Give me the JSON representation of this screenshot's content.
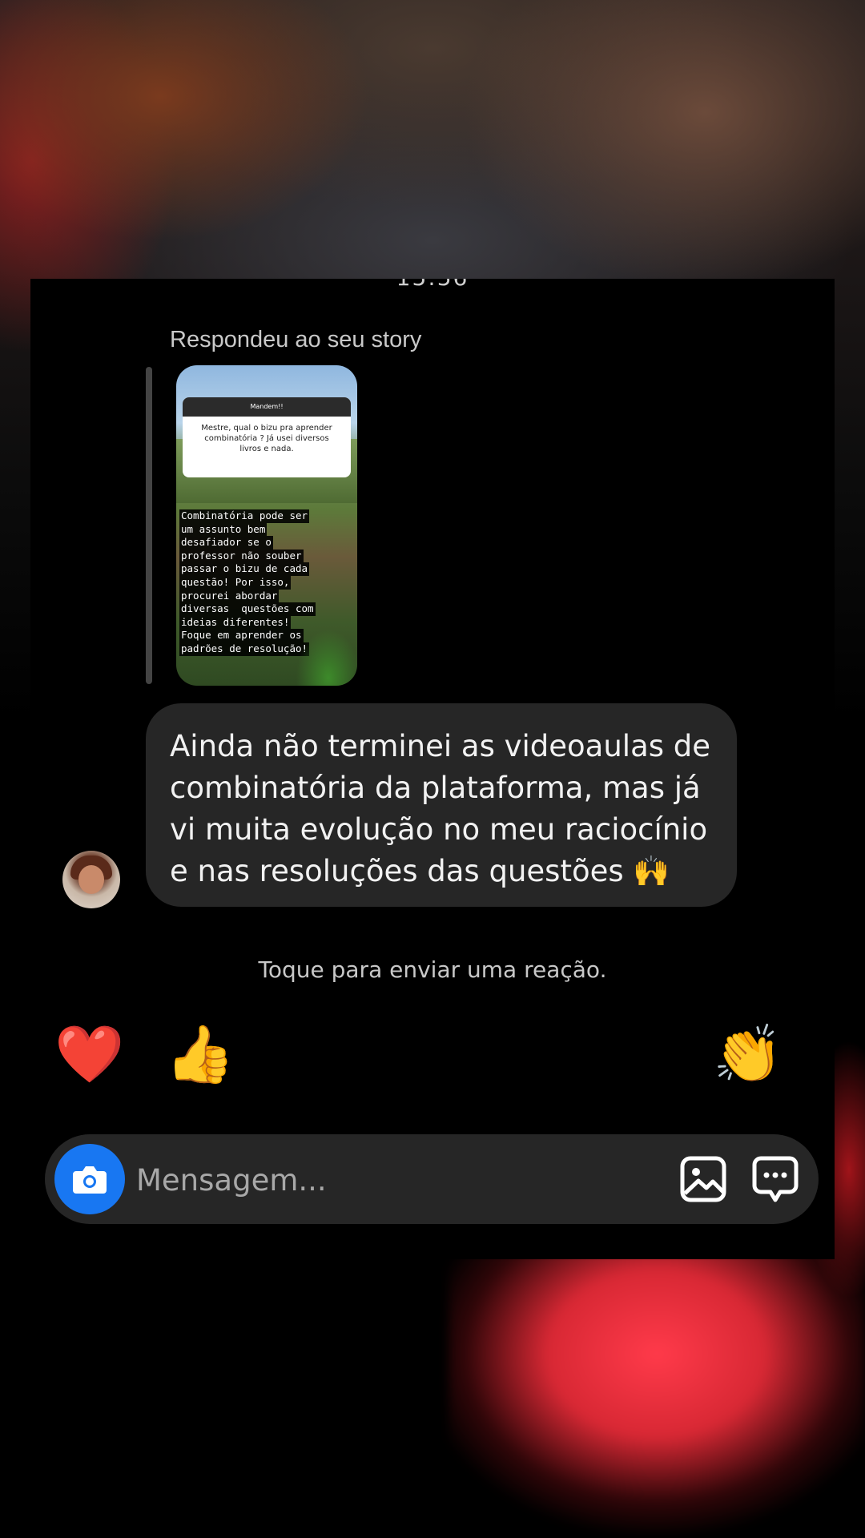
{
  "status_time_partial": "15:56",
  "thread": {
    "replied_label": "Respondeu ao seu story",
    "story": {
      "question_header": "Mandem!!",
      "question_text": "Mestre, qual o bizu pra aprender combinatória ? Já usei diversos livros e nada.",
      "answer_lines": [
        "Combinatória pode ser",
        "um assunto bem",
        "desafiador se o",
        "professor não souber",
        "passar o bizu de cada",
        "questão! Por isso,",
        "procurei abordar",
        "diversas  questões com",
        "ideias diferentes!",
        "Foque em aprender os",
        "padrões de resolução!"
      ]
    },
    "message_text": "Ainda não terminei as videoaulas de combinatória da plataforma, mas já vi muita evolução no meu raciocínio e nas resoluções das questões 🙌"
  },
  "reactions": {
    "hint": "Toque para enviar uma reação.",
    "emojis": [
      "❤️",
      "👍",
      "😢",
      "😍",
      "😮",
      "😂",
      "👏"
    ]
  },
  "composer": {
    "placeholder": "Mensagem...",
    "camera_icon": "camera-icon",
    "gallery_icon": "image-icon",
    "sticker_icon": "chat-bubble-dots-icon"
  },
  "colors": {
    "panel_bg": "#000000",
    "bubble_bg": "#262626",
    "composer_bg": "#262626",
    "camera_blue": "#1877f2"
  }
}
